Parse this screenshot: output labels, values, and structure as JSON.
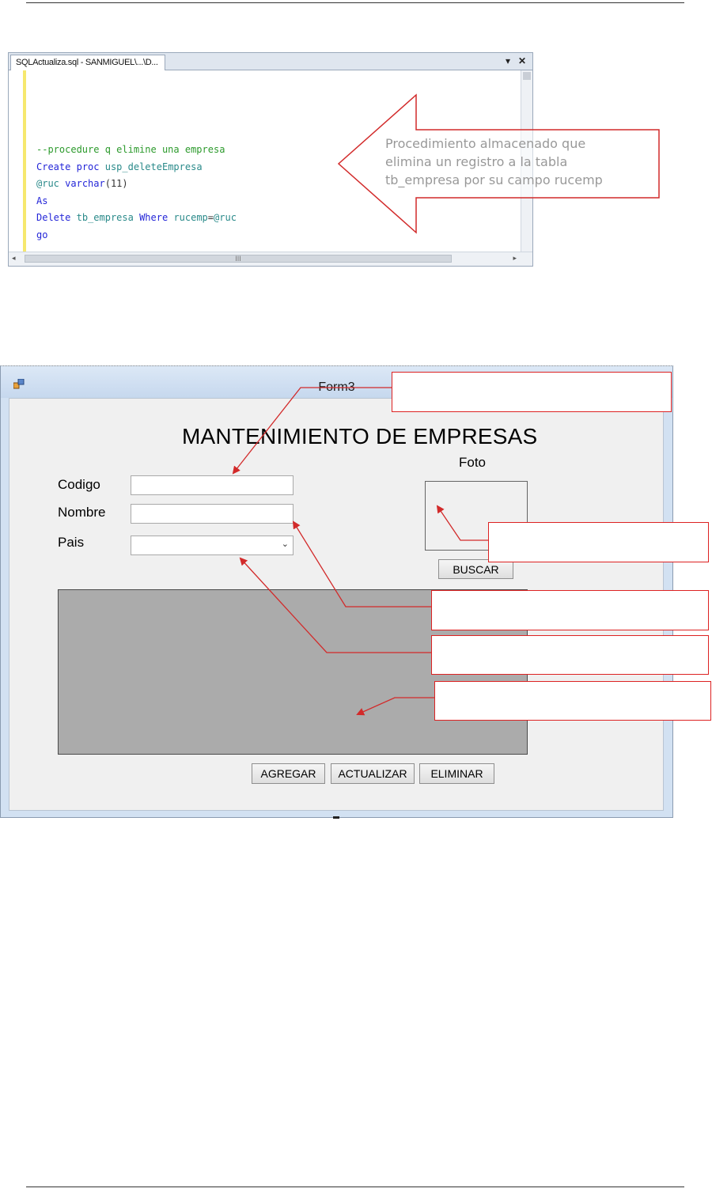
{
  "editor": {
    "tab_title": "SQLActualiza.sql - SANMIGUEL\\...\\D...",
    "pin_icon": "dropdown-arrow-icon",
    "close_icon": "close-icon",
    "code_lines": [
      "--procedure q elimine una empresa",
      "Create proc usp_deleteEmpresa",
      "@ruc varchar(11)",
      "As",
      "Delete tb_empresa Where rucemp=@ruc",
      "go"
    ],
    "hscroll_marker": "III"
  },
  "arrow_callout": {
    "text_lines": [
      "Procedimiento almacenado que",
      "elimina un registro a la tabla",
      "tb_empresa por su campo rucemp"
    ],
    "border_color": "#d22a2a"
  },
  "form": {
    "window_title": "Form3",
    "heading": "MANTENIMIENTO DE EMPRESAS",
    "photo_label": "Foto",
    "labels": {
      "codigo": "Codigo",
      "nombre": "Nombre",
      "pais": "Pais"
    },
    "inputs": {
      "codigo_value": "",
      "nombre_value": "",
      "pais_selected": ""
    },
    "buttons": {
      "buscar": "BUSCAR",
      "agregar": "AGREGAR",
      "actualizar": "ACTUALIZAR",
      "eliminar": "ELIMINAR"
    },
    "grid_color": "#ababab"
  },
  "callouts": {
    "color": "#d22a2a",
    "boxes": [
      "",
      "",
      "",
      "",
      ""
    ]
  }
}
